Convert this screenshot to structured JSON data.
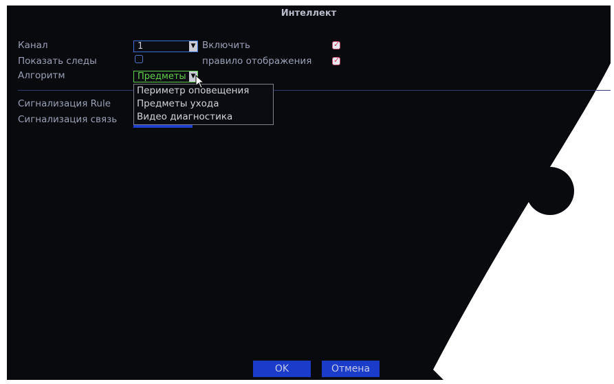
{
  "window": {
    "title": "Интеллект"
  },
  "form": {
    "channel_label": "Канал",
    "channel_value": "1",
    "enable_label": "Включить",
    "enable_checked": true,
    "show_traces_label": "Показать следы",
    "show_traces_checked": false,
    "display_rule_label": "правило отображения",
    "display_rule_checked": true,
    "algorithm_label": "Алгоритм",
    "algorithm_value": "Предметы",
    "alarm_rule_label": "Сигнализация Rule",
    "alarm_link_label": "Сигнализация связь"
  },
  "dropdown": {
    "options": [
      "Периметр оповещения",
      "Предметы ухода",
      "Видео диагностика"
    ]
  },
  "buttons": {
    "ok": "OK",
    "cancel": "Отмена"
  },
  "colors": {
    "accent": "#1b3cc9",
    "background": "#090a0e",
    "selected_text": "#5fd14a"
  }
}
